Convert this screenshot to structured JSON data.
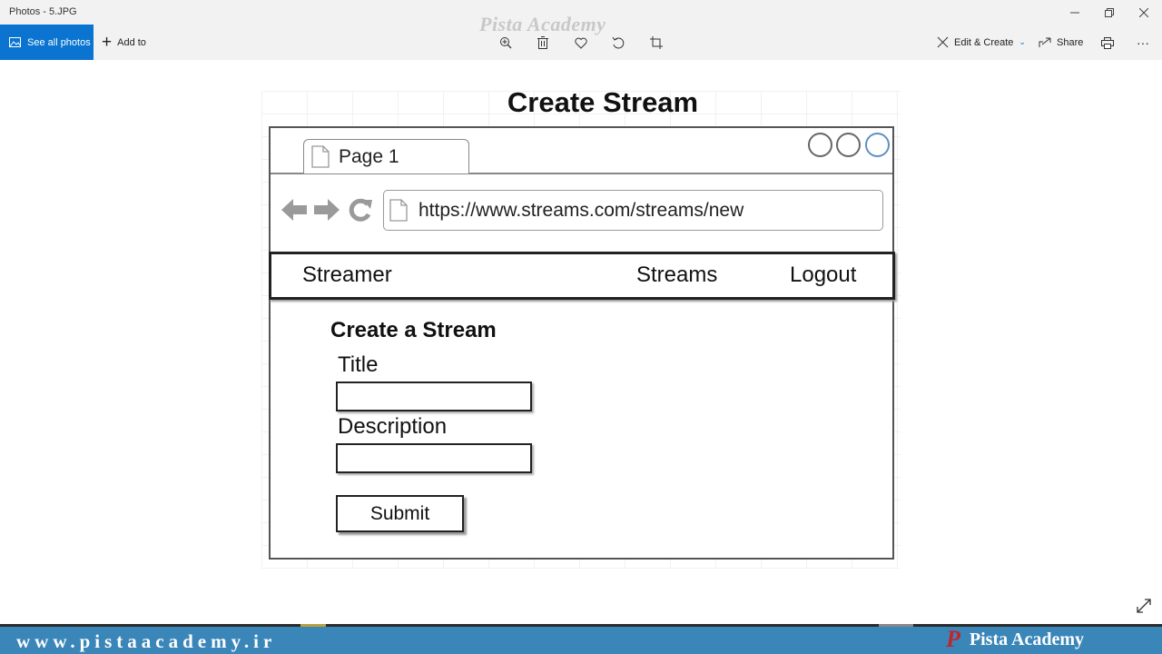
{
  "window": {
    "title": "Photos - 5.JPG",
    "watermark": "Pista Academy"
  },
  "toolbar": {
    "see_all_label": "See all photos",
    "add_to_label": "Add to",
    "edit_create_label": "Edit & Create",
    "share_label": "Share",
    "more_label": "···"
  },
  "mockup": {
    "heading": "Create Stream",
    "tab_label": "Page 1",
    "url": "https://www.streams.com/streams/new",
    "nav": {
      "brand": "Streamer",
      "streams": "Streams",
      "logout": "Logout"
    },
    "form": {
      "title": "Create a Stream",
      "title_label": "Title",
      "title_value": "",
      "description_label": "Description",
      "description_value": "",
      "submit_label": "Submit"
    }
  },
  "banner": {
    "site": "www.pistaacademy.ir",
    "brand": "Pista Academy",
    "logo_letter": "P"
  },
  "colors": {
    "accent": "#0a74d0",
    "banner": "#3a86b9",
    "logo": "#c0262c"
  }
}
